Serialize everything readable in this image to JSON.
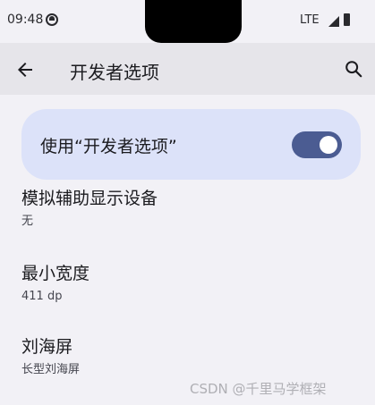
{
  "status_bar": {
    "time": "09:48",
    "network": "LTE"
  },
  "app_bar": {
    "title": "开发者选项",
    "back_icon": "arrow-back-icon",
    "search_icon": "search-icon"
  },
  "master_switch": {
    "label": "使用“开发者选项”",
    "checked": true,
    "track_color": "#4b5c92",
    "card_color": "#dce2f9"
  },
  "preferences": [
    {
      "title": "模拟辅助显示设备",
      "summary": "无"
    },
    {
      "title": "最小宽度",
      "summary": "411 dp"
    },
    {
      "title": "刘海屏",
      "summary": "长型刘海屏"
    }
  ],
  "watermark": "CSDN @千里马学框架"
}
